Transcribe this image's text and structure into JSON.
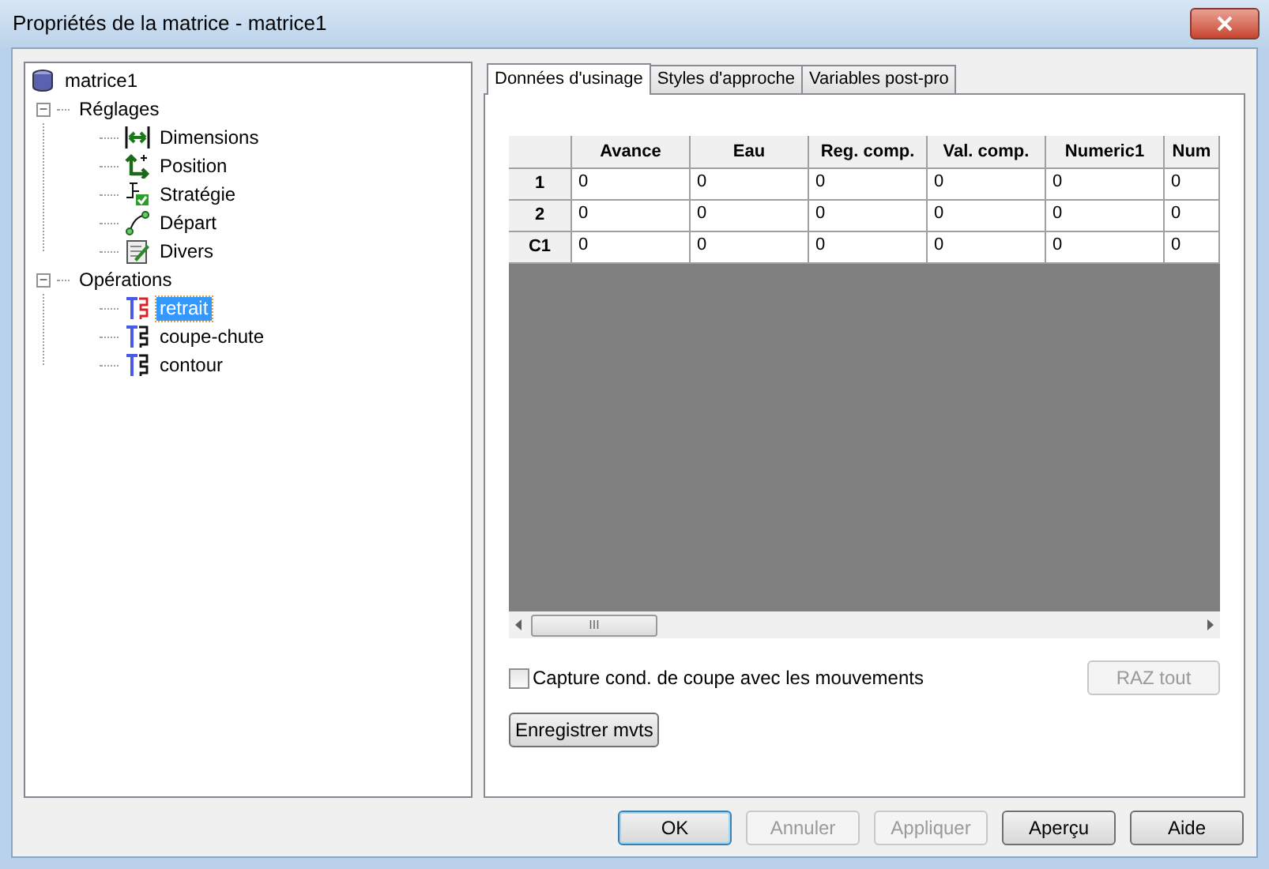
{
  "window": {
    "title": "Propriétés de la matrice - matrice1"
  },
  "tree": [
    {
      "label": "matrice1",
      "kind": "cylinder",
      "selected": false,
      "children": [
        {
          "label": "Réglages",
          "expanded": true,
          "selected": false,
          "expander": "−",
          "children": [
            {
              "label": "Dimensions",
              "kind": "dimensions",
              "selected": false
            },
            {
              "label": "Position",
              "kind": "position",
              "selected": false
            },
            {
              "label": "Stratégie",
              "kind": "strategy",
              "selected": false
            },
            {
              "label": "Départ",
              "kind": "start",
              "selected": false
            },
            {
              "label": "Divers",
              "kind": "notes",
              "selected": false
            }
          ]
        },
        {
          "label": "Opérations",
          "expanded": true,
          "selected": false,
          "expander": "−",
          "children": [
            {
              "label": "retrait",
              "kind": "tool-red",
              "selected": true
            },
            {
              "label": "coupe-chute",
              "kind": "tool",
              "selected": false
            },
            {
              "label": "contour",
              "kind": "tool",
              "selected": false
            }
          ]
        }
      ]
    }
  ],
  "tabs": [
    {
      "label": "Données d'usinage",
      "selected": true
    },
    {
      "label": "Styles d'approche",
      "selected": false
    },
    {
      "label": "Variables post-pro",
      "selected": false
    }
  ],
  "table": {
    "columns": [
      "Avance",
      "Eau",
      "Reg. comp.",
      "Val. comp.",
      "Numeric1",
      "Num"
    ],
    "rows": [
      {
        "header": "1",
        "cells": [
          "0",
          "0",
          "0",
          "0",
          "0",
          "0"
        ]
      },
      {
        "header": "2",
        "cells": [
          "0",
          "0",
          "0",
          "0",
          "0",
          "0"
        ]
      },
      {
        "header": "C1",
        "cells": [
          "0",
          "0",
          "0",
          "0",
          "0",
          "0"
        ]
      }
    ],
    "scroll_grip": "III"
  },
  "checkbox": {
    "label": "Capture cond. de coupe avec les mouvements",
    "checked": false
  },
  "raz_button": {
    "label": "RAZ tout",
    "disabled": true
  },
  "record_button": {
    "label": "Enregistrer mvts",
    "disabled": false
  },
  "buttons": [
    {
      "label": "OK",
      "disabled": false,
      "default": true
    },
    {
      "label": "Annuler",
      "disabled": true,
      "default": false
    },
    {
      "label": "Appliquer",
      "disabled": true,
      "default": false
    },
    {
      "label": "Aperçu",
      "disabled": false,
      "default": false
    },
    {
      "label": "Aide",
      "disabled": false,
      "default": false
    }
  ]
}
